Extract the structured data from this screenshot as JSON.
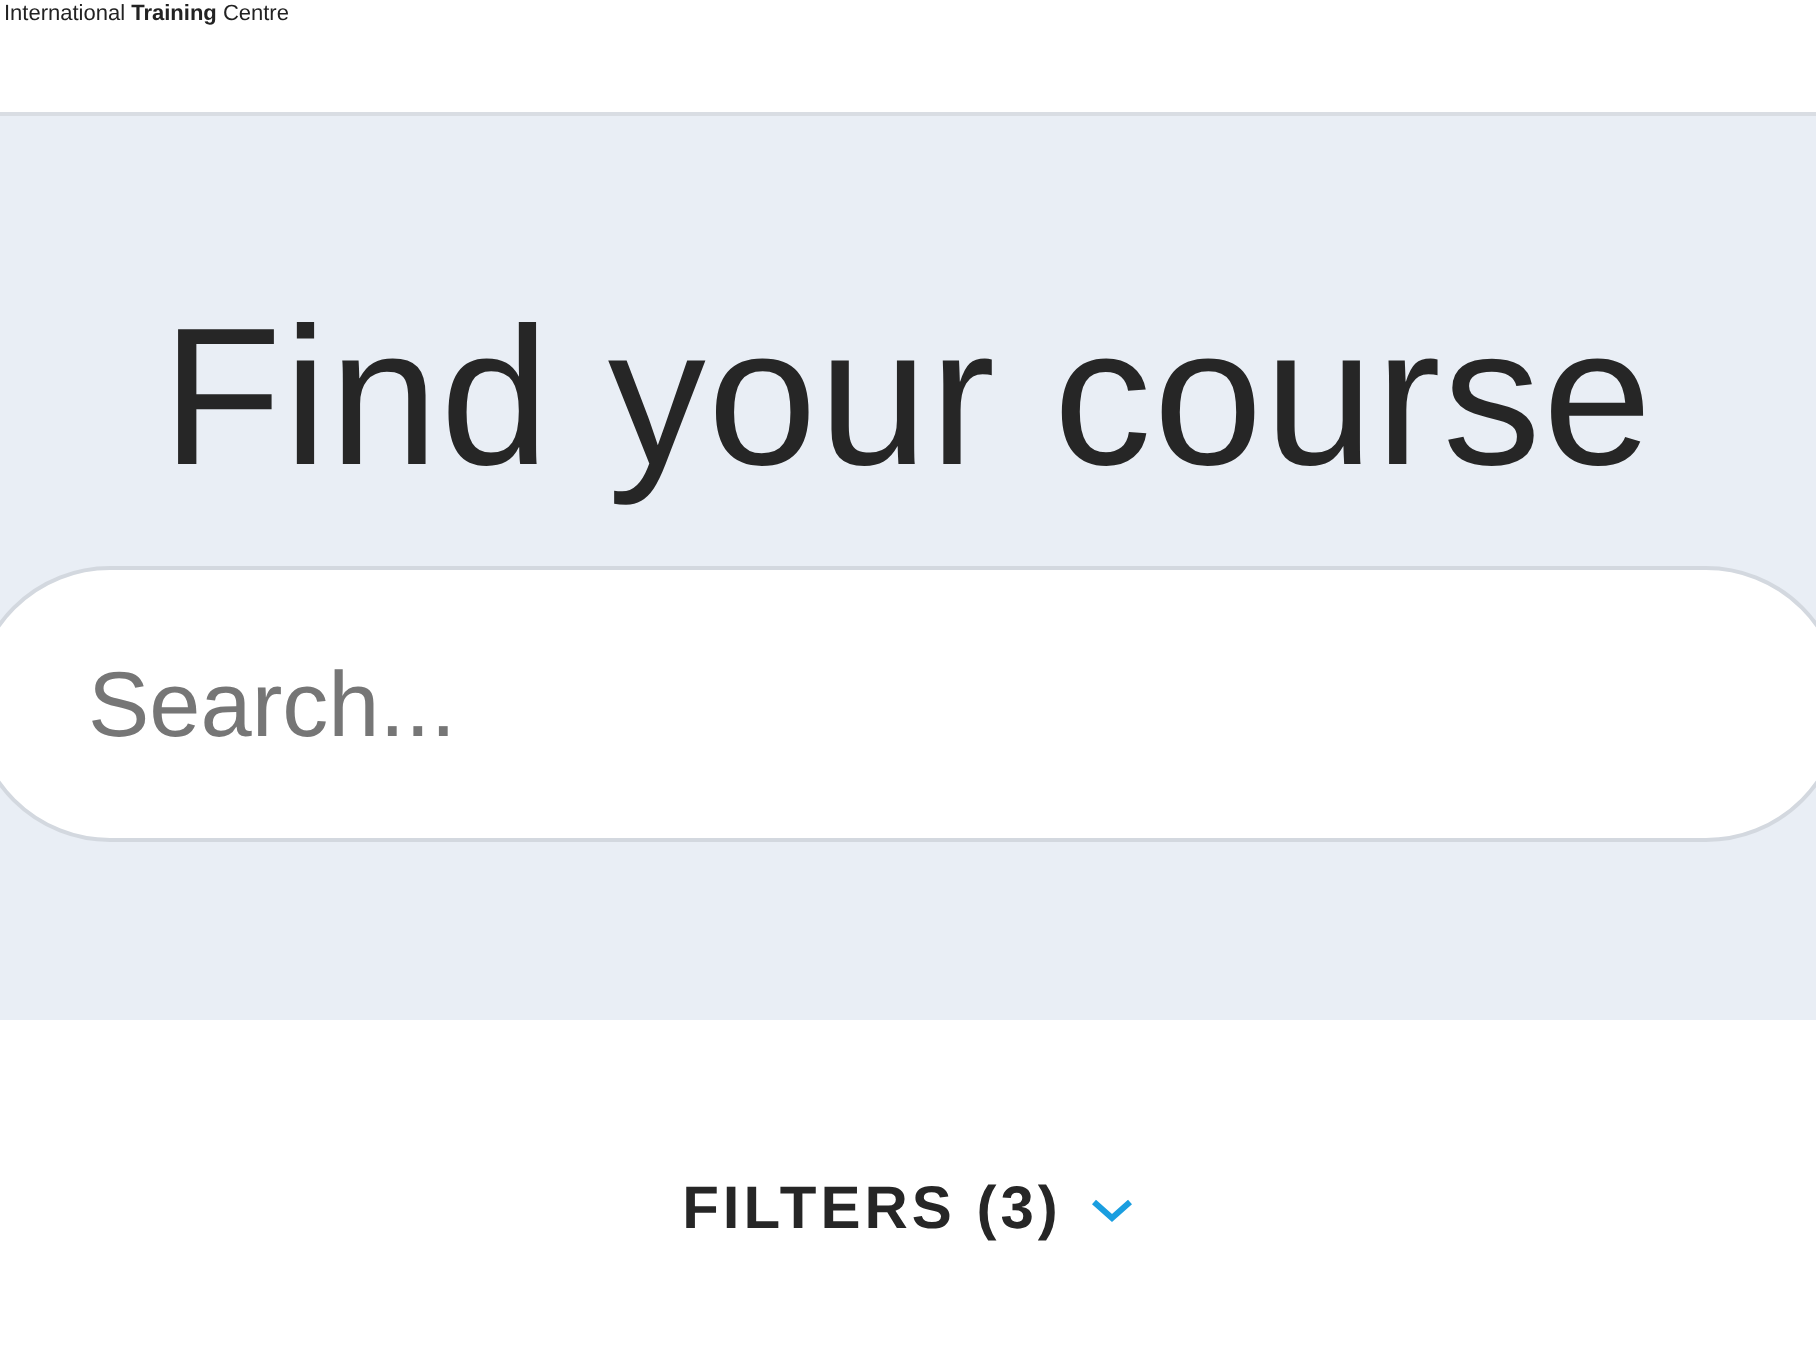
{
  "header": {
    "logo_text": "International **Training** Centre"
  },
  "hero": {
    "title": "Find your course",
    "search": {
      "placeholder": "Search..."
    }
  },
  "filters": {
    "label": "FILTERS (3)",
    "expanded": false
  }
}
